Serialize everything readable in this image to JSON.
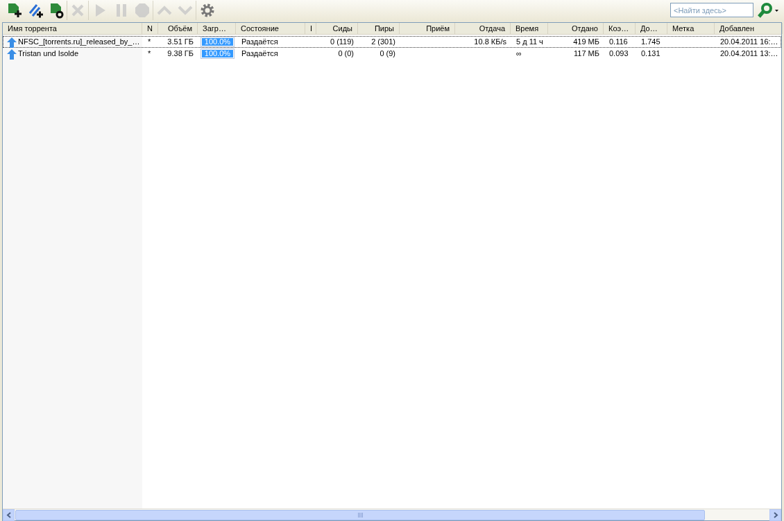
{
  "toolbar": [
    {
      "disabled": false
    },
    {
      "disabled": false
    },
    {
      "disabled": false
    },
    {
      "disabled": true
    },
    {
      "disabled": true
    },
    {
      "disabled": true
    },
    {
      "disabled": true
    },
    {
      "disabled": true
    },
    {
      "disabled": true
    },
    {
      "disabled": false
    }
  ],
  "search": {
    "placeholder": "<Найти здесь>"
  },
  "table": {
    "columns": [
      {
        "label": "Имя торрента"
      },
      {
        "label": "N"
      },
      {
        "label": "Объём"
      },
      {
        "label": "Загр…"
      },
      {
        "label": "Состояние"
      },
      {
        "label": "I"
      },
      {
        "label": "Сиды"
      },
      {
        "label": "Пиры"
      },
      {
        "label": "Приём"
      },
      {
        "label": "Отдача"
      },
      {
        "label": "Время"
      },
      {
        "label": "Отдано"
      },
      {
        "label": "Коэ…"
      },
      {
        "label": "До…"
      },
      {
        "label": "Метка"
      },
      {
        "label": "Добавлен"
      }
    ],
    "rows": [
      {
        "selected": true,
        "name": "NFSC_[torrents.ru]_released_by_…",
        "n": "*",
        "size": "3.51 ГБ",
        "progress": {
          "level": 1,
          "text": "100.0%"
        },
        "status": "Раздаётся",
        "seeds": "0 (119)",
        "peers": "2 (301)",
        "upload": "10.8 КБ/s",
        "time": "5 д 11 ч",
        "uploaded": "419 МБ",
        "ratio": "0.116",
        "availability": "1.745",
        "added": "20.04.2011 16:…"
      },
      {
        "selected": false,
        "name": "Tristan und Isolde",
        "n": "*",
        "size": "9.38 ГБ",
        "progress": {
          "level": 1,
          "text": "100.0%"
        },
        "status": "Раздаётся",
        "seeds": "0 (0)",
        "peers": "0 (9)",
        "time": "∞",
        "uploaded": "117 МБ",
        "ratio": "0.093",
        "availability": "0.131",
        "added": "20.04.2011 13:…"
      }
    ]
  }
}
